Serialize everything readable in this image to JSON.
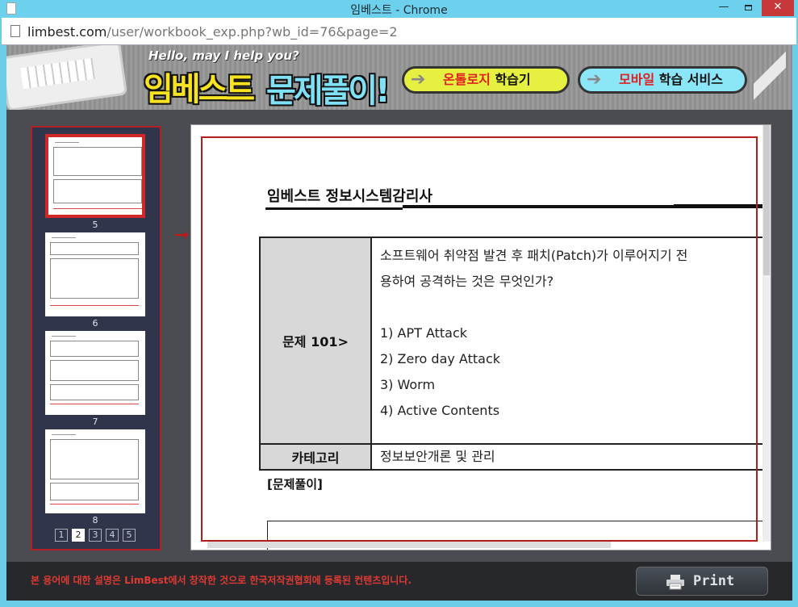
{
  "window": {
    "title": "임베스트 - Chrome",
    "close_glyph": "✕",
    "min_glyph": "—"
  },
  "address": {
    "domain": "limbest.com",
    "path": "/user/workbook_exp.php?wb_id=76&page=2"
  },
  "banner": {
    "hello": "Hello, may I help you?",
    "logo_part1": "임베스트",
    "logo_part2": "문제풀이!",
    "btn1_highlight": "온톨로지",
    "btn1_rest": " 학습기",
    "btn2_highlight": "모바일",
    "btn2_rest": " 학습 서비스",
    "arrow_glyph": "➔"
  },
  "thumbnails": [
    {
      "number": "5",
      "selected": true
    },
    {
      "number": "6",
      "selected": false
    },
    {
      "number": "7",
      "selected": false
    },
    {
      "number": "8",
      "selected": false
    }
  ],
  "pager": {
    "pages": [
      "1",
      "2",
      "3",
      "4",
      "5"
    ],
    "active": "2"
  },
  "indicator_glyph": "➞",
  "document": {
    "title": "임베스트  정보시스템감리사",
    "question_label": "문제  101>",
    "question_line1": "소프트웨어  취약점  발견  후  패치(Patch)가  이루어지기  전",
    "question_line2": "용하여  공격하는  것은  무엇인가?",
    "options": [
      "1) APT Attack",
      "2) Zero day Attack",
      "3) Worm",
      "4) Active Contents"
    ],
    "category_label": "카테고리",
    "category_value": "정보보안개론  및  관리",
    "solution_label": "[문제풀이]"
  },
  "footer": {
    "notice": "본 용어에 대한 설명은 LimBest에서 창작한 것으로 한국저작권협회에 등록된 컨텐츠입니다.",
    "print_label": "Print"
  },
  "colors": {
    "accent_red": "#b71c1c",
    "sidebar": "#30354c",
    "footer_text": "#e03a32"
  }
}
